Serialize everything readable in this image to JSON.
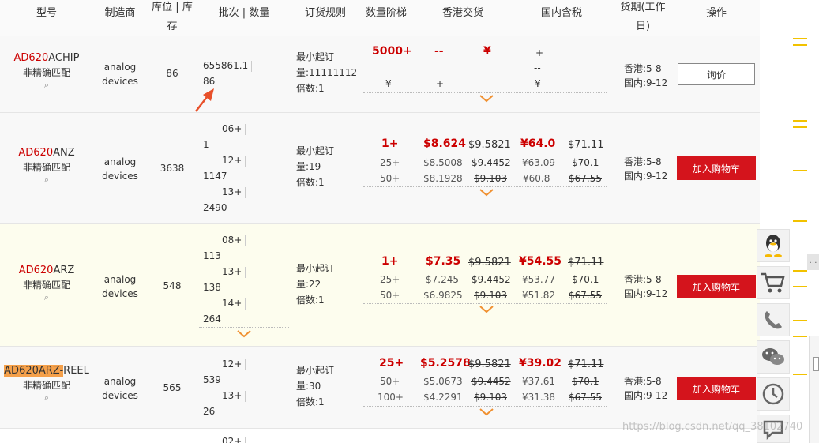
{
  "header": {
    "model": "型号",
    "maker": "制造商",
    "stock": "库位 | 库存",
    "lot": "批次 | 数量",
    "order_rule": "订货规则",
    "tiers": "数量阶梯",
    "hk": "香港交货",
    "cn": "国内含税",
    "lead": "货期(工作日)",
    "action": "操作"
  },
  "rows": [
    {
      "model_prefix": "AD620",
      "model_suffix": "ACHIP",
      "match": "非精确匹配",
      "maker1": "analog",
      "maker2": "devices",
      "stock": "86",
      "lots": [
        "655861.1",
        "86"
      ],
      "order_min": "最小起订",
      "order_qty": "量:11111112",
      "order_mult": "倍数:1",
      "tier_top": "5000+",
      "tier_bottom": "¥",
      "hk_top": "--",
      "hk_bottom": "+",
      "hk2_top": "¥",
      "hk2_bottom": "--",
      "cn_top": "+",
      "cn_mid": "--",
      "cn_bottom": "¥",
      "lead_hk": "香港:5-8",
      "lead_cn": "国内:9-12",
      "action": "询价"
    },
    {
      "model_prefix": "AD620",
      "model_suffix": "ANZ",
      "match": "非精确匹配",
      "maker1": "analog",
      "maker2": "devices",
      "stock": "3638",
      "lots": [
        "06+",
        "1",
        "12+",
        "1147",
        "13+",
        "2490"
      ],
      "order_min": "最小起订",
      "order_qty": "量:19",
      "order_mult": "倍数:1",
      "tiers": [
        "1+",
        "25+",
        "50+"
      ],
      "hk_price": [
        "$8.624",
        "$8.5008",
        "$8.1928"
      ],
      "hk_orig": [
        "$9.5821",
        "$9.4452",
        "$9.103"
      ],
      "cn_price": [
        "¥64.0",
        "¥63.09",
        "¥60.8"
      ],
      "cn_orig": [
        "$71.11",
        "$70.1",
        "$67.55"
      ],
      "lead_hk": "香港:5-8",
      "lead_cn": "国内:9-12",
      "action": "加入购物车"
    },
    {
      "model_prefix": "AD620",
      "model_suffix": "ARZ",
      "match": "非精确匹配",
      "maker1": "analog",
      "maker2": "devices",
      "stock": "548",
      "lots": [
        "08+",
        "113",
        "13+",
        "138",
        "14+",
        "264"
      ],
      "order_min": "最小起订",
      "order_qty": "量:22",
      "order_mult": "倍数:1",
      "tiers": [
        "1+",
        "25+",
        "50+"
      ],
      "hk_price": [
        "$7.35",
        "$7.245",
        "$6.9825"
      ],
      "hk_orig": [
        "$9.5821",
        "$9.4452",
        "$9.103"
      ],
      "cn_price": [
        "¥54.55",
        "¥53.77",
        "¥51.82"
      ],
      "cn_orig": [
        "$71.11",
        "$70.1",
        "$67.55"
      ],
      "lead_hk": "香港:5-8",
      "lead_cn": "国内:9-12",
      "action": "加入购物车"
    },
    {
      "model_prefix": "AD620ARZ-",
      "model_suffix": "REEL",
      "match": "非精确匹配",
      "maker1": "analog",
      "maker2": "devices",
      "stock": "565",
      "lots": [
        "12+",
        "539",
        "13+",
        "26"
      ],
      "order_min": "最小起订",
      "order_qty": "量:30",
      "order_mult": "倍数:1",
      "tiers": [
        "25+",
        "50+",
        "100+"
      ],
      "hk_price": [
        "$5.2578",
        "$5.0673",
        "$4.2291"
      ],
      "hk_orig": [
        "$9.5821",
        "$9.4452",
        "$9.103"
      ],
      "cn_price": [
        "¥39.02",
        "¥37.61",
        "¥31.38"
      ],
      "cn_orig": [
        "$71.11",
        "$70.1",
        "$67.55"
      ],
      "lead_hk": "香港:5-8",
      "lead_cn": "国内:9-12",
      "action": "加入购物车"
    }
  ],
  "next_row_lot": "02+",
  "watermark": "https://blog.csdn.net/qq_38102740",
  "sidebar": [
    "qq-icon",
    "cart-icon",
    "phone-icon",
    "wechat-icon",
    "clock-icon",
    "chat-icon"
  ],
  "colors": {
    "accent": "#c00000",
    "cart_button": "#d4141c",
    "highlight": "#f5a04a",
    "row_bg_alt": "#fdfdee",
    "arrow": "#e8502a",
    "ruler": "#f2c200"
  }
}
